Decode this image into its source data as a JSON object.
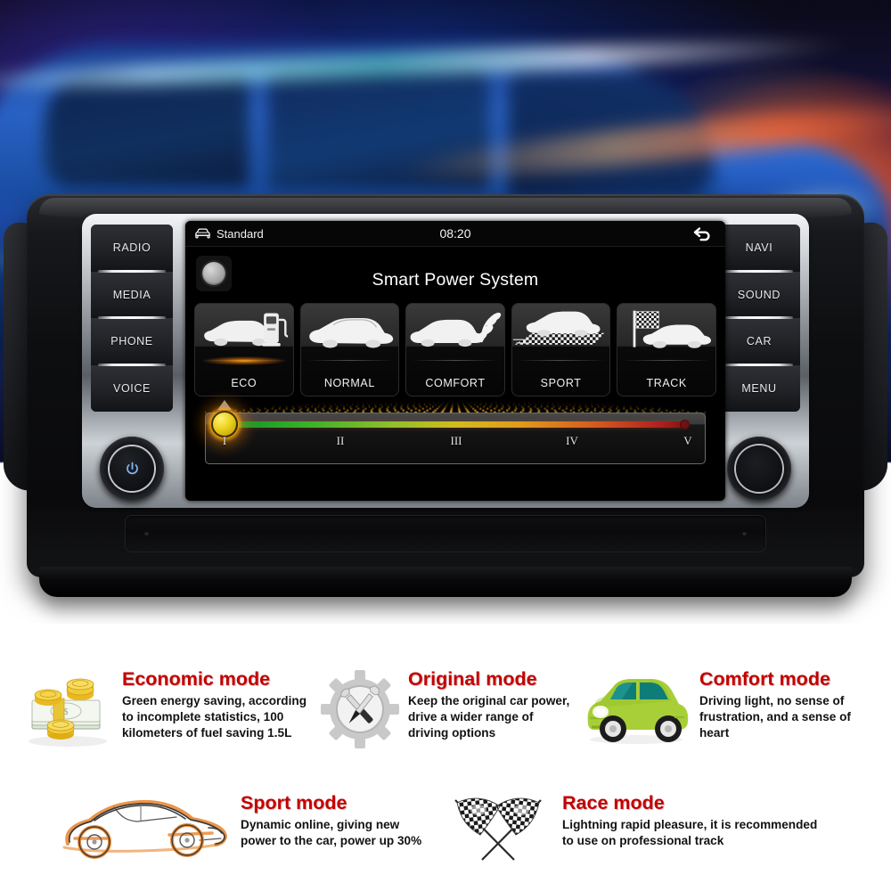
{
  "hero": {
    "alt_description": "blurred blue car with motion light streaks"
  },
  "head_unit": {
    "left_buttons": [
      {
        "label": "RADIO",
        "name": "radio"
      },
      {
        "label": "MEDIA",
        "name": "media"
      },
      {
        "label": "PHONE",
        "name": "phone"
      },
      {
        "label": "VOICE",
        "name": "voice"
      }
    ],
    "right_buttons": [
      {
        "label": "NAVI",
        "name": "navi"
      },
      {
        "label": "SOUND",
        "name": "sound"
      },
      {
        "label": "CAR",
        "name": "car"
      },
      {
        "label": "MENU",
        "name": "menu"
      }
    ],
    "power_knob": {
      "icon": "power-icon"
    },
    "volume_knob": {
      "icon": "rotary-knob"
    }
  },
  "screen": {
    "status_bar": {
      "source_icon": "car-icon",
      "source_label": "Standard",
      "clock": "08:20",
      "back_icon": "back-arrow-icon"
    },
    "title": "Smart Power System",
    "modes": [
      {
        "label": "ECO",
        "icon": "car-fuel-pump-icon",
        "active": true
      },
      {
        "label": "NORMAL",
        "icon": "car-icon",
        "active": false
      },
      {
        "label": "COMFORT",
        "icon": "car-leaf-icon",
        "active": false
      },
      {
        "label": "SPORT",
        "icon": "car-speed-icon",
        "active": false
      },
      {
        "label": "TRACK",
        "icon": "car-flag-icon",
        "active": false
      }
    ],
    "slider": {
      "ticks": [
        "I",
        "II",
        "III",
        "IV",
        "V"
      ],
      "selected_index": 0,
      "gradient": [
        "#0d8f2a",
        "#8fc02a",
        "#d2bb1f",
        "#d65a1f",
        "#7a1414"
      ],
      "knob_color": "#ecd21f"
    }
  },
  "info_panel": {
    "cards": [
      {
        "title": "Economic mode",
        "body": "Green energy saving, according to incomplete statistics, 100 kilometers of fuel saving 1.5L",
        "icon": "money-cash-coins-icon"
      },
      {
        "title": "Original  mode",
        "body": "Keep the original car power, drive a wider range of driving options",
        "icon": "gear-tools-icon"
      },
      {
        "title": "Comfort mode",
        "body": "Driving light, no sense of frustration, and a sense of heart",
        "icon": "green-car-icon"
      },
      {
        "title": "Sport mode",
        "body": "Dynamic online, giving new power to the car, power up 30%",
        "icon": "sports-car-sketch-icon"
      },
      {
        "title": "Race mode",
        "body": "Lightning rapid pleasure, it is recommended to use on professional track",
        "icon": "checkered-flags-icon"
      }
    ],
    "title_color": "#c40000"
  }
}
